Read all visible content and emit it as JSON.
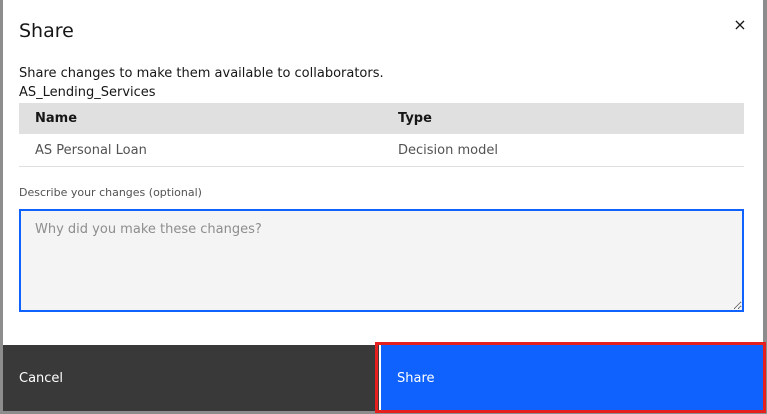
{
  "dialog": {
    "title": "Share",
    "close_icon": "×",
    "description": "Share changes to make them available to collaborators.",
    "project": "AS_Lending_Services"
  },
  "table": {
    "headers": [
      "Name",
      "Type"
    ],
    "rows": [
      [
        "AS Personal Loan",
        "Decision model"
      ]
    ]
  },
  "comment": {
    "label": "Describe your changes (optional)",
    "placeholder": "Why did you make these changes?",
    "value": ""
  },
  "footer": {
    "cancel": "Cancel",
    "share": "Share"
  },
  "colors": {
    "primary": "#0f62fe",
    "secondary": "#393939",
    "highlight": "#e51e1e"
  }
}
